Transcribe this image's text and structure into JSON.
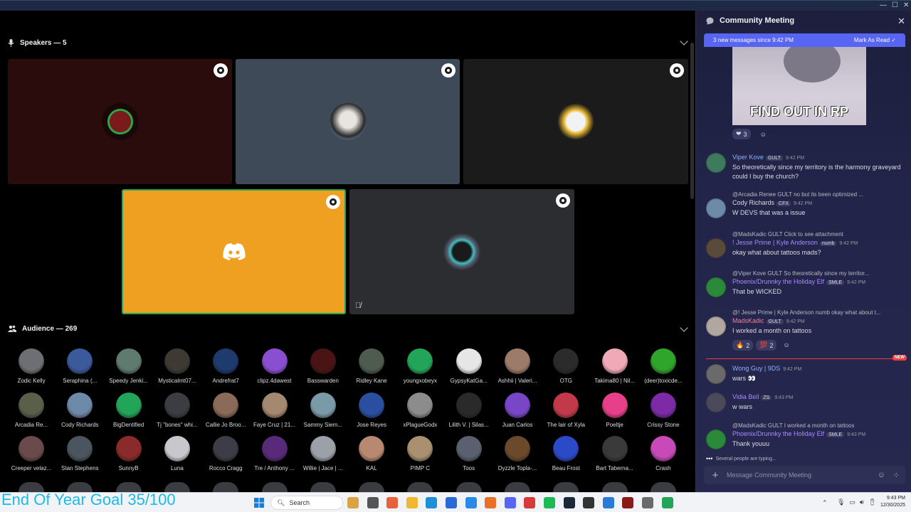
{
  "speakers": {
    "label": "Speakers — 5"
  },
  "audience": {
    "label": "Audience — 269",
    "rows": [
      [
        {
          "name": "Zodic Kelly",
          "color": "#6d6f73"
        },
        {
          "name": "Seraphina (...",
          "color": "#3b5a9c"
        },
        {
          "name": "Speedy Jenki...",
          "color": "#5f7a6e"
        },
        {
          "name": "Mysticalmt07...",
          "color": "#3e3a33"
        },
        {
          "name": "Andrefrat7",
          "color": "#1e3a6e"
        },
        {
          "name": "clipz.4dawest",
          "color": "#8a4fd0"
        },
        {
          "name": "Basswarden",
          "color": "#4a1414"
        },
        {
          "name": "Ridley Kane",
          "color": "#4e5b4f"
        },
        {
          "name": "youngxobeyx",
          "color": "#23a559"
        },
        {
          "name": "GypsyKatGa...",
          "color": "#e6e6e6"
        },
        {
          "name": "Ashhii | Valeri...",
          "color": "#9c7b6b"
        },
        {
          "name": "OTG",
          "color": "#2b2b2b"
        },
        {
          "name": "Takima80 | Nil...",
          "color": "#f0a9b6"
        },
        {
          "name": "(deer)toxicde...",
          "color": "#2fa52b"
        }
      ],
      [
        {
          "name": "Arcadia Re...",
          "color": "#5a5f4a"
        },
        {
          "name": "Cody Richards",
          "color": "#6d8aa8"
        },
        {
          "name": "BigDentified",
          "color": "#23a559"
        },
        {
          "name": "Tj \"bones\" whi...",
          "color": "#3b3d42"
        },
        {
          "name": "Callie Jo Broo...",
          "color": "#8a6a58"
        },
        {
          "name": "Faye Cruz | 21...",
          "color": "#a48870"
        },
        {
          "name": "Sammy Siem...",
          "color": "#7b9aa8"
        },
        {
          "name": "Jose Reyes",
          "color": "#2b4fa0"
        },
        {
          "name": "xPlagueGodx",
          "color": "#8c8c8c"
        },
        {
          "name": "Lilith V. | Silas...",
          "color": "#2a2a2a"
        },
        {
          "name": "Juan Carlos",
          "color": "#7a46c8"
        },
        {
          "name": "The lair of Xyla",
          "color": "#c23a4a"
        },
        {
          "name": "Poeltje",
          "color": "#e83f8a"
        },
        {
          "name": "Crissy Stone",
          "color": "#7c2aa6"
        }
      ],
      [
        {
          "name": "Creeper velaz...",
          "color": "#6a4a4a"
        },
        {
          "name": "Stan Stephens",
          "color": "#4b5560"
        },
        {
          "name": "SunnyB",
          "color": "#8a2a2a"
        },
        {
          "name": "Luna",
          "color": "#c8c8cc"
        },
        {
          "name": "Rocco Cragg",
          "color": "#3c3d48"
        },
        {
          "name": "Tre / Anthony ...",
          "color": "#5a2a7a"
        },
        {
          "name": "Willie | Jace | ...",
          "color": "#9ca0a8"
        },
        {
          "name": "KAL",
          "color": "#b88870"
        },
        {
          "name": "PIMP C",
          "color": "#a89070"
        },
        {
          "name": "Toos",
          "color": "#5a6070"
        },
        {
          "name": "Dyzzle Topla-...",
          "color": "#6a4a2a"
        },
        {
          "name": "Beau Frost",
          "color": "#2a4ac8"
        },
        {
          "name": "Bart Taberna...",
          "color": "#3a3a3a"
        },
        {
          "name": "Crash",
          "color": "#c84ab8"
        }
      ]
    ]
  },
  "chat": {
    "title": "Community Meeting",
    "new_messages": "3 new messages since 9:42 PM",
    "mark_read": "Mark As Read",
    "image_caption": "FIND OUT IN RP",
    "image_reaction_count": "3",
    "messages": [
      {
        "reply": "",
        "user": "Viper Kove",
        "user_color": "#8ab4f8",
        "tag": "GULT",
        "time": "9:42 PM",
        "text": "So theoretically since my territory is the harmony graveyard could I buy the church?",
        "avatar": "#3e7a5e"
      },
      {
        "reply": "@Arcadia Renee  GULT  no but its been optimized ...",
        "user": "Cody Richards",
        "user_color": "#dbdee1",
        "tag": "CFX",
        "time": "9:42 PM",
        "text": "W DEVS that was a issue",
        "avatar": "#6d8aa8"
      },
      {
        "reply": "@MadsKadic  GULT  Click to see attachment",
        "user": "! Jesse Prime | Kyle Anderson",
        "user_color": "#a78bfa",
        "tag": "numb",
        "time": "9:42 PM",
        "text": "okay what about tattoos mads?",
        "avatar": "#5a4a3a"
      },
      {
        "reply": "@Viper Kove  GULT  So theoretically since my territor...",
        "user": "Phoenix/Drunnky the Holiday Elf",
        "user_color": "#a78bfa",
        "tag": "SMLE",
        "time": "9:42 PM",
        "text": "That be WICKED",
        "avatar": "#2a8a3a"
      },
      {
        "reply": "@! Jesse Prime | Kyle Anderson  numb  okay what about t...",
        "user": "MadsKadic",
        "user_color": "#f47fa0",
        "tag": "GULT",
        "time": "9:42 PM",
        "text": "I worked a month on tattoos",
        "avatar": "#b0a8a0"
      },
      {
        "reply": "",
        "user": "Wong Guy | 9DS",
        "user_color": "#8ab4f8",
        "tag": "",
        "time": "9:42 PM",
        "text": "wars 👀",
        "avatar": "#6a6a6a"
      },
      {
        "reply": "",
        "user": "Vidia Bell",
        "user_color": "#a78bfa",
        "tag": "ZS",
        "time": "9:43 PM",
        "text": "w wars",
        "avatar": "#4a4a5a"
      },
      {
        "reply": "@MadsKadic  GULT  I worked a month on tattoos",
        "user": "Phoenix/Drunnky the Holiday Elf",
        "user_color": "#a78bfa",
        "tag": "SMLE",
        "time": "9:43 PM",
        "text": "Thank youuu",
        "avatar": "#2a8a3a"
      }
    ],
    "reactions_mads": [
      {
        "emoji": "🔥",
        "count": "2"
      },
      {
        "emoji": "💯",
        "count": "2"
      }
    ],
    "new_badge": "NEW",
    "typing": "Several people are typing...",
    "composer_placeholder": "Message Community Meeting"
  },
  "taskbar": {
    "overlay_text": "End Of Year Goal 35/100",
    "search_label": "Search",
    "time": "9:43 PM",
    "date": "12/30/2025"
  }
}
